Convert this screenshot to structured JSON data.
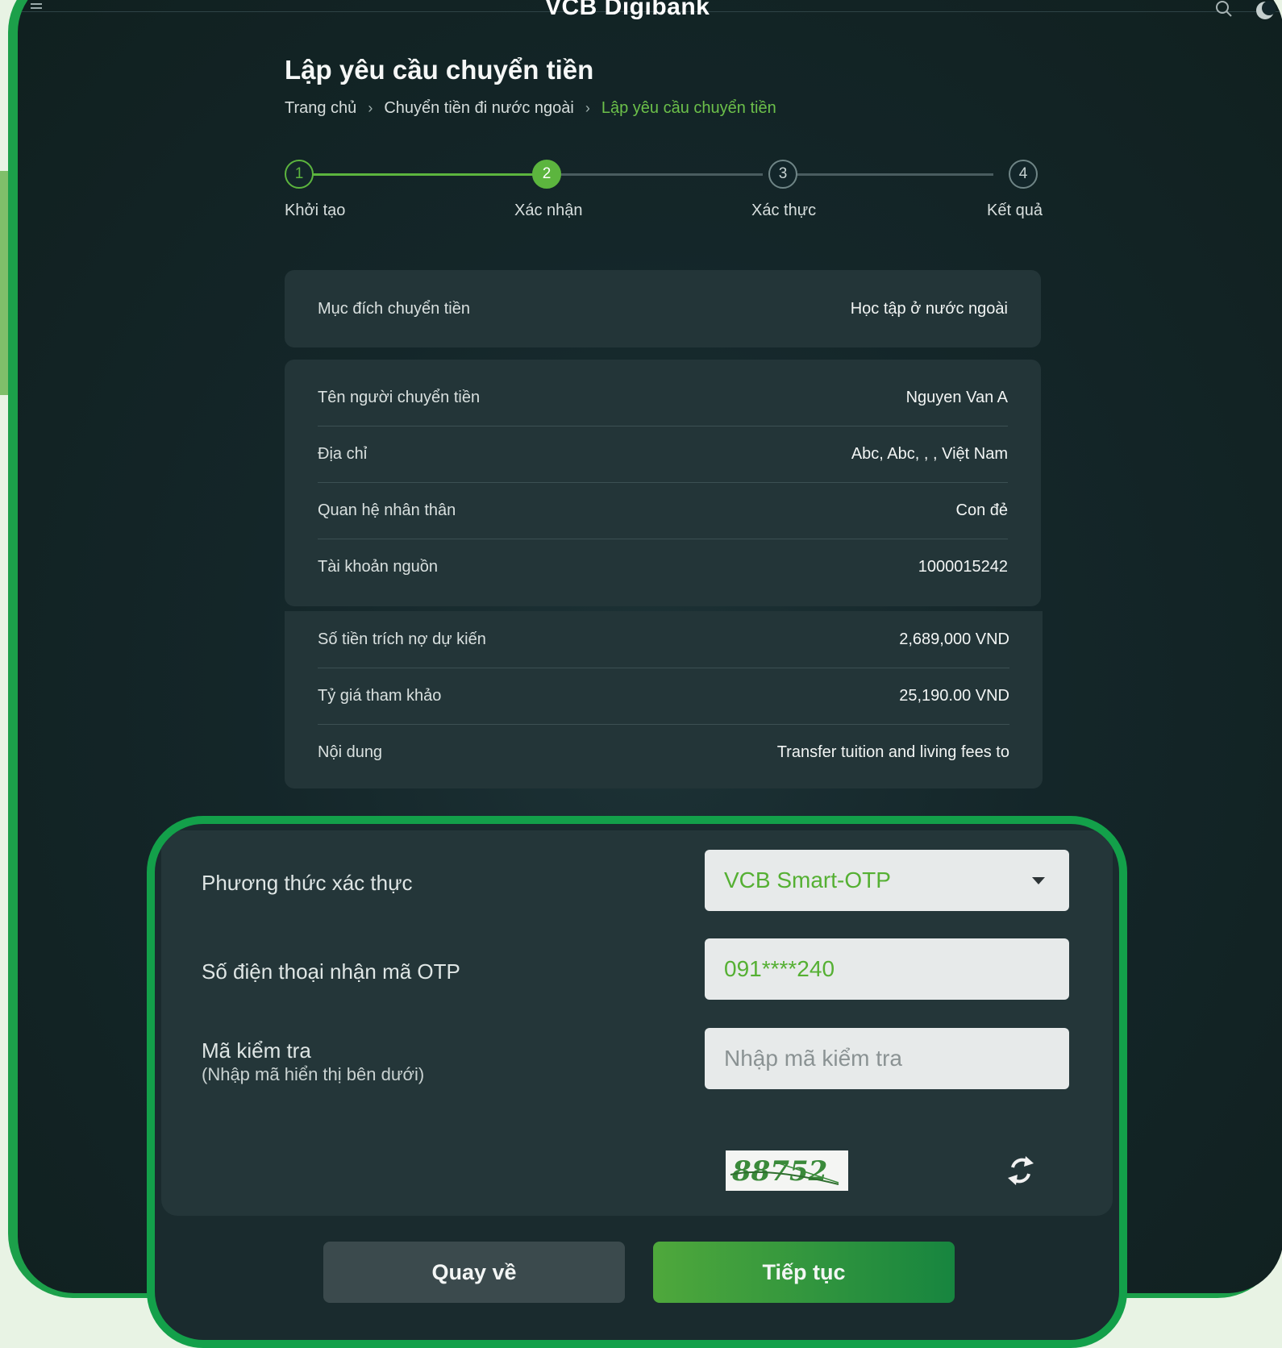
{
  "app": {
    "brand": "VCB Digibank"
  },
  "page": {
    "title": "Lập yêu cầu chuyển tiền",
    "breadcrumb": [
      "Trang chủ",
      "Chuyển tiền đi nước ngoài",
      "Lập yêu cầu chuyển tiền"
    ]
  },
  "stepper": {
    "steps": [
      {
        "number": "1",
        "label": "Khởi tạo",
        "state": "done"
      },
      {
        "number": "2",
        "label": "Xác nhận",
        "state": "active"
      },
      {
        "number": "3",
        "label": "Xác thực",
        "state": "pending"
      },
      {
        "number": "4",
        "label": "Kết quả",
        "state": "pending"
      }
    ]
  },
  "purpose": {
    "label": "Mục đích chuyển tiền",
    "value": "Học tập ở nước ngoài"
  },
  "sender": [
    {
      "label": "Tên người chuyển tiền",
      "value": "Nguyen Van A"
    },
    {
      "label": "Địa chỉ",
      "value": "Abc, Abc, , , Việt Nam"
    },
    {
      "label": "Quan hệ nhân thân",
      "value": "Con đẻ"
    },
    {
      "label": "Tài khoản nguồn",
      "value": "1000015242"
    }
  ],
  "amounts": [
    {
      "label": "Số tiền trích nợ dự kiến",
      "value": "2,689,000 VND"
    },
    {
      "label": "Tỷ giá tham khảo",
      "value": "25,190.00 VND"
    },
    {
      "label": "Nội dung",
      "value": "Transfer tuition and living fees to"
    }
  ],
  "auth": {
    "method_label": "Phương thức xác thực",
    "method_value": "VCB Smart-OTP",
    "phone_label": "Số điện thoại nhận mã OTP",
    "phone_value": "091****240",
    "captcha_label": "Mã kiểm tra",
    "captcha_hint": "(Nhập mã hiển thị bên dưới)",
    "captcha_placeholder": "Nhập mã kiểm tra",
    "captcha_text": "88752"
  },
  "buttons": {
    "back": "Quay về",
    "next": "Tiếp tục"
  },
  "colors": {
    "accent": "#5cb53e",
    "frame": "#13a04a",
    "background": "#13262a"
  }
}
